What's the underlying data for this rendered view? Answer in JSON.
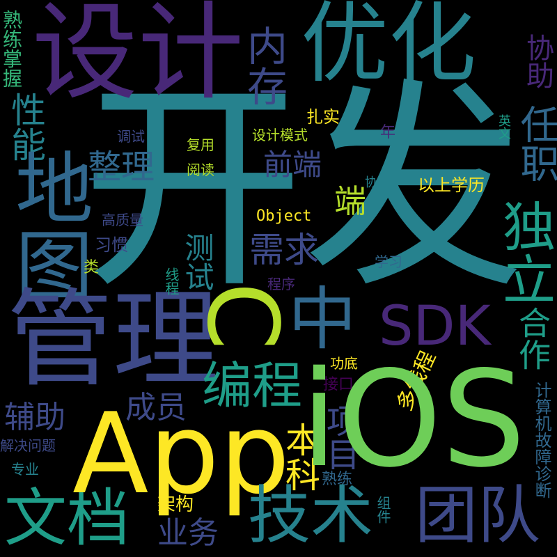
{
  "colors": {
    "background": "#000000",
    "yellow": "#fde725",
    "lime": "#b5de2b",
    "green": "#35b779",
    "lightgreen": "#6ece58",
    "teal": "#26828e",
    "tealdark": "#1f9e89",
    "blue": "#3e4a89",
    "navy": "#31688e",
    "purple": "#482878",
    "deeppurple": "#440154"
  },
  "words": {
    "kaifa": "开发",
    "sheji": "设计",
    "youhua": "优化",
    "neicun": "内存",
    "xiezhu": "协助",
    "renzhi": "任职",
    "duli": "独立",
    "ditu": "地图",
    "xingneng": "性能",
    "guanli": "管理",
    "c": "C",
    "zhong": "中",
    "sdk": "SDK",
    "hezuo": "合作",
    "app": "App",
    "ios": "iOS",
    "wendang": "文档",
    "jishu": "技术",
    "tuandui": "团队",
    "biancheng": "编程",
    "zhengli": "整理",
    "qianduan": "前端",
    "duan": "端",
    "xuqiu": "需求",
    "ceshi": "测试",
    "xiangmu": "项目",
    "benke": "本科",
    "fuzhu": "辅助",
    "chengyuan": "成员",
    "duoxiancheng": "多线程",
    "yewu": "业务",
    "jiagou": "架构",
    "shulian": "熟练",
    "jiekou": "接口",
    "gongdi": "功底",
    "zhuanye": "专业",
    "jiejuewenti": "解决问题",
    "zujian": "组件",
    "jisuanji": "计算机故障诊断",
    "shulianzhangwo": "熟练掌握",
    "tiaoshi": "调试",
    "fuyong": "复用",
    "yuedu": "阅读",
    "shejimoshi": "设计模式",
    "zhashi": "扎实",
    "nian": "年",
    "yingwen": "英文",
    "yishangxueli": "以上学历",
    "xie": "协",
    "object": "Object",
    "gaozhiliang": "高质量",
    "xiguan": "习惯",
    "lei": "类",
    "xiancheng": "线程",
    "chengxu": "程序",
    "xuexi": "学习"
  }
}
